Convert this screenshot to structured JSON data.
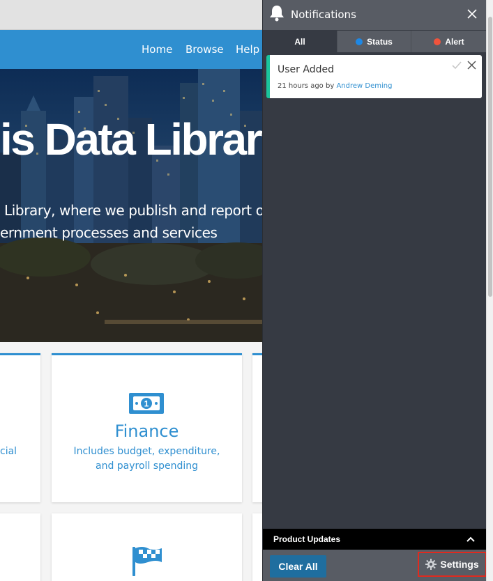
{
  "site": {
    "nav": {
      "home": "Home",
      "browse": "Browse",
      "help": "Help"
    },
    "hero": {
      "title": "is Data Library",
      "subtitle_line1": "Library, where we publish and report on",
      "subtitle_line2": "ernment processes and services"
    },
    "cards": {
      "left_partial_text": "cial",
      "finance_icon": "money-bill-icon",
      "finance_title": "Finance",
      "finance_description": "Includes budget, expenditure, and payroll spending",
      "flag_icon": "flag-icon"
    },
    "accent_color": "#2f8fd0"
  },
  "notifications": {
    "title": "Notifications",
    "tabs": [
      {
        "label": "All",
        "active": true
      },
      {
        "label": "Status",
        "dot_color": "#1e88e5"
      },
      {
        "label": "Alert",
        "dot_color": "#f0533c"
      }
    ],
    "items": [
      {
        "title": "User Added",
        "time": "21 hours ago",
        "by": "by",
        "user": "Andrew Deming",
        "stripe_color": "#1bc49c"
      }
    ],
    "product_updates_label": "Product Updates",
    "clear_all_label": "Clear All",
    "settings_label": "Settings",
    "highlight_color": "#e02a1f"
  }
}
